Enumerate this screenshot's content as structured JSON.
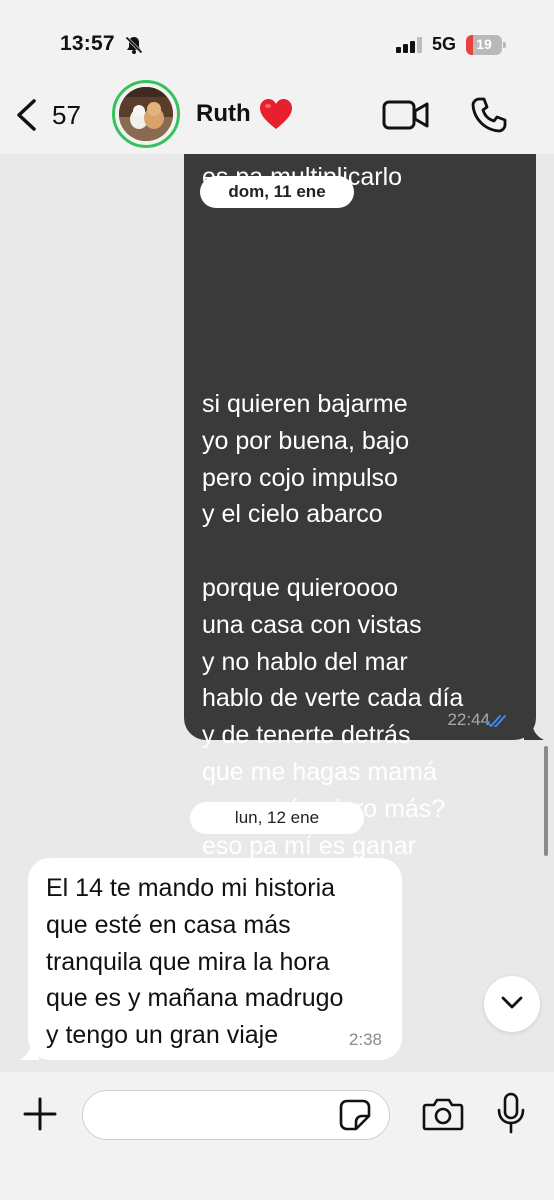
{
  "status_bar": {
    "time": "13:57",
    "network": "5G",
    "battery_level": "19",
    "battery_fraction": 0.19
  },
  "header": {
    "back_count": "57",
    "contact_name": "Ruth",
    "heart": "❤️"
  },
  "messages": {
    "date_1": "dom, 11 ene",
    "outgoing": {
      "cut_off_line": "es pa multiplicarlo",
      "lines": [
        "si quieren bajarme",
        "yo por buena, bajo",
        "pero cojo impulso",
        "y el cielo abarco",
        "",
        "porque quieroooo",
        "una casa con vistas",
        "y no hablo del mar",
        "hablo de verte cada día",
        "y de tenerte detrás",
        "que me hagas mamá",
        "para qué quiero más?",
        "eso pa mí es ganar"
      ],
      "time": "22:44",
      "status": "read"
    },
    "date_2": "lun, 12 ene",
    "incoming": {
      "lines": [
        "El 14 te mando mi historia",
        "que esté en casa más",
        "tranquila que mira la hora",
        "que es y mañana madrugo",
        "y tengo un gran viaje"
      ],
      "time": "2:38"
    }
  },
  "composer": {
    "placeholder": ""
  },
  "colors": {
    "outgoing_bubble": "#3a3a3a",
    "incoming_bubble": "#ffffff",
    "read_ticks": "#3b8ff5",
    "story_ring": "#35c25a"
  }
}
